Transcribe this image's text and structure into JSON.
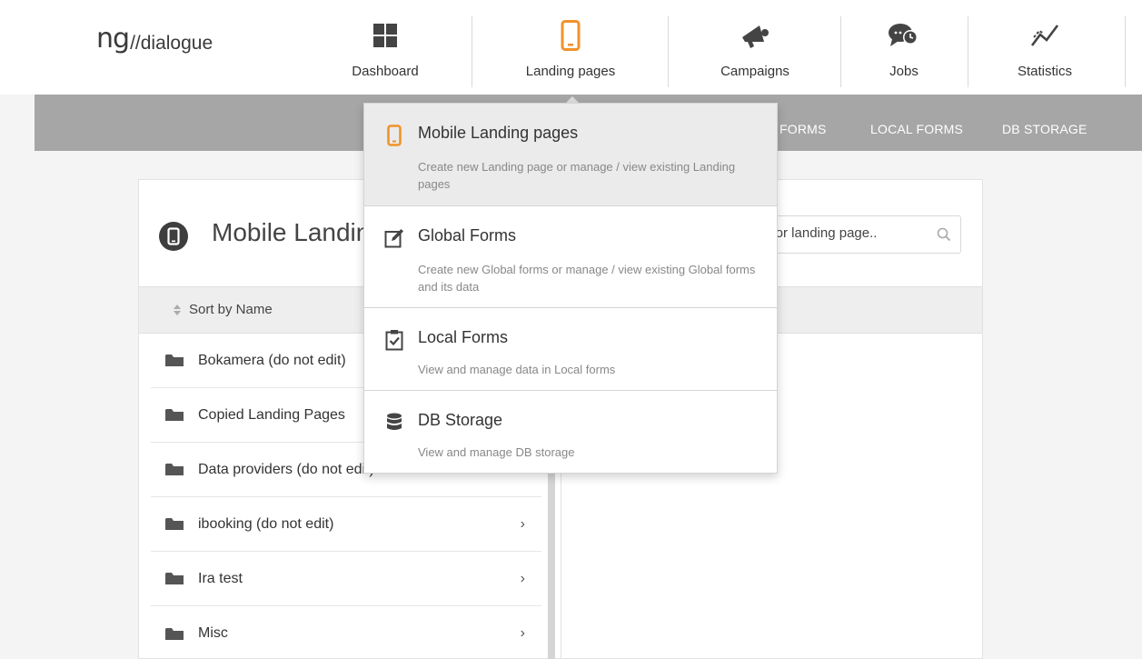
{
  "header": {
    "logo_mark": "ng",
    "logo_word": "//dialogue",
    "nav": [
      {
        "label": "Dashboard",
        "icon": "dashboard-grid-icon"
      },
      {
        "label": "Landing pages",
        "icon": "mobile-phone-icon"
      },
      {
        "label": "Campaigns",
        "icon": "megaphone-icon"
      },
      {
        "label": "Jobs",
        "icon": "jobs-chat-clock-icon"
      },
      {
        "label": "Statistics",
        "icon": "statistics-trend-icon"
      }
    ]
  },
  "subnav": {
    "items": [
      "FORMS",
      "LOCAL FORMS",
      "DB STORAGE"
    ]
  },
  "panel": {
    "title": "Mobile Landing pages",
    "search_value": "h for landing page..",
    "sort_label": "Sort by Name",
    "folders": [
      "Bokamera (do not edit)",
      "Copied Landing Pages",
      "Data providers (do not edit)",
      "ibooking (do not edit)",
      "Ira test",
      "Misc"
    ]
  },
  "dropdown": {
    "items": [
      {
        "title": "Mobile Landing pages",
        "desc": "Create new Landing page or manage / view existing Landing pages"
      },
      {
        "title": "Global Forms",
        "desc": "Create new Global forms or manage / view existing Global forms and its data"
      },
      {
        "title": "Local Forms",
        "desc": "View and manage data in Local forms"
      },
      {
        "title": "DB Storage",
        "desc": "View and manage DB storage"
      }
    ]
  },
  "colors": {
    "accent_orange": "#f0932b",
    "subnav_bg": "#a6a6a6",
    "icon_dark": "#444444"
  }
}
